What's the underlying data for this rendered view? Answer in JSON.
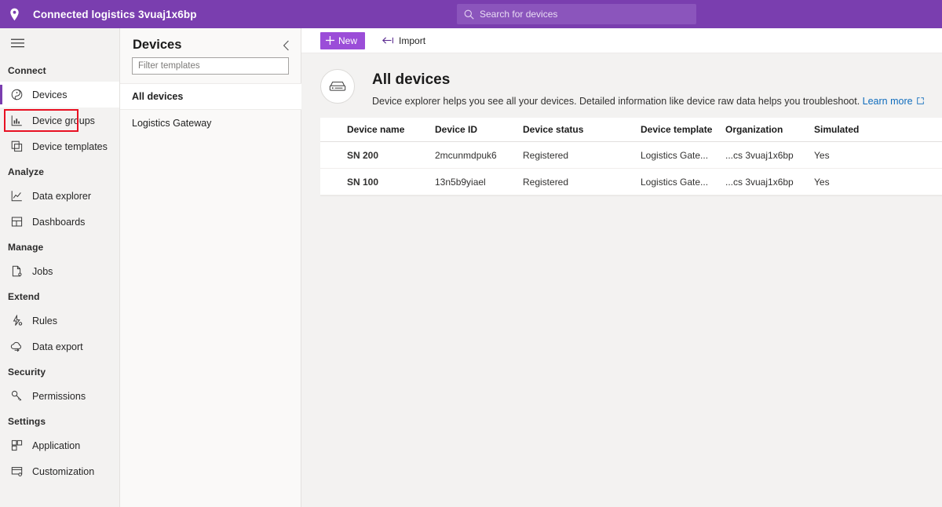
{
  "header": {
    "pin_icon": "location-pin-icon",
    "app_title": "Connected logistics 3vuaj1x6bp",
    "search": {
      "icon": "search-icon",
      "placeholder": "Search for devices"
    },
    "bg_color": "#7a3eaf"
  },
  "sidebar": {
    "menu_icon": "hamburger-menu-icon",
    "groups": [
      {
        "label": "Connect",
        "items": [
          {
            "label": "Devices",
            "icon": "devices-icon",
            "selected": true,
            "highlighted": true
          },
          {
            "label": "Device groups",
            "icon": "device-groups-icon",
            "selected": false
          },
          {
            "label": "Device templates",
            "icon": "device-templates-icon",
            "selected": false
          }
        ]
      },
      {
        "label": "Analyze",
        "items": [
          {
            "label": "Data explorer",
            "icon": "data-explorer-icon",
            "selected": false
          },
          {
            "label": "Dashboards",
            "icon": "dashboards-icon",
            "selected": false
          }
        ]
      },
      {
        "label": "Manage",
        "items": [
          {
            "label": "Jobs",
            "icon": "jobs-icon",
            "selected": false
          }
        ]
      },
      {
        "label": "Extend",
        "items": [
          {
            "label": "Rules",
            "icon": "rules-icon",
            "selected": false
          },
          {
            "label": "Data export",
            "icon": "data-export-icon",
            "selected": false
          }
        ]
      },
      {
        "label": "Security",
        "items": [
          {
            "label": "Permissions",
            "icon": "permissions-key-icon",
            "selected": false
          }
        ]
      },
      {
        "label": "Settings",
        "items": [
          {
            "label": "Application",
            "icon": "application-icon",
            "selected": false
          },
          {
            "label": "Customization",
            "icon": "customization-icon",
            "selected": false
          }
        ]
      }
    ],
    "highlight_color": "#e81123",
    "accent_color": "#7a3eaf"
  },
  "list_panel": {
    "title": "Devices",
    "collapse_icon": "chevron-left-icon",
    "filter": {
      "value": "",
      "placeholder": "Filter templates"
    },
    "entries": [
      {
        "label": "All devices",
        "active": true
      },
      {
        "label": "Logistics Gateway",
        "active": false
      }
    ]
  },
  "command_bar": {
    "new_label": "New",
    "new_icon": "plus-icon",
    "new_color": "#9b4dd8",
    "import_label": "Import",
    "import_icon": "import-arrow-icon"
  },
  "page": {
    "icon": "device-explorer-icon",
    "title": "All devices",
    "description": "Device explorer helps you see all your devices. Detailed information like device raw data helps you troubleshoot.",
    "learn_more_label": "Learn more",
    "learn_more_icon": "external-link-icon",
    "link_color": "#0f6cbd"
  },
  "table": {
    "columns": [
      "Device name",
      "Device ID",
      "Device status",
      "Device template",
      "Organization",
      "Simulated"
    ],
    "rows": [
      {
        "device_name": "SN 200",
        "device_id": "2mcunmdpuk6",
        "device_status": "Registered",
        "device_template": "Logistics Gate...",
        "organization": "...cs 3vuaj1x6bp",
        "simulated": "Yes"
      },
      {
        "device_name": "SN 100",
        "device_id": "13n5b9yiael",
        "device_status": "Registered",
        "device_template": "Logistics Gate...",
        "organization": "...cs 3vuaj1x6bp",
        "simulated": "Yes"
      }
    ]
  }
}
